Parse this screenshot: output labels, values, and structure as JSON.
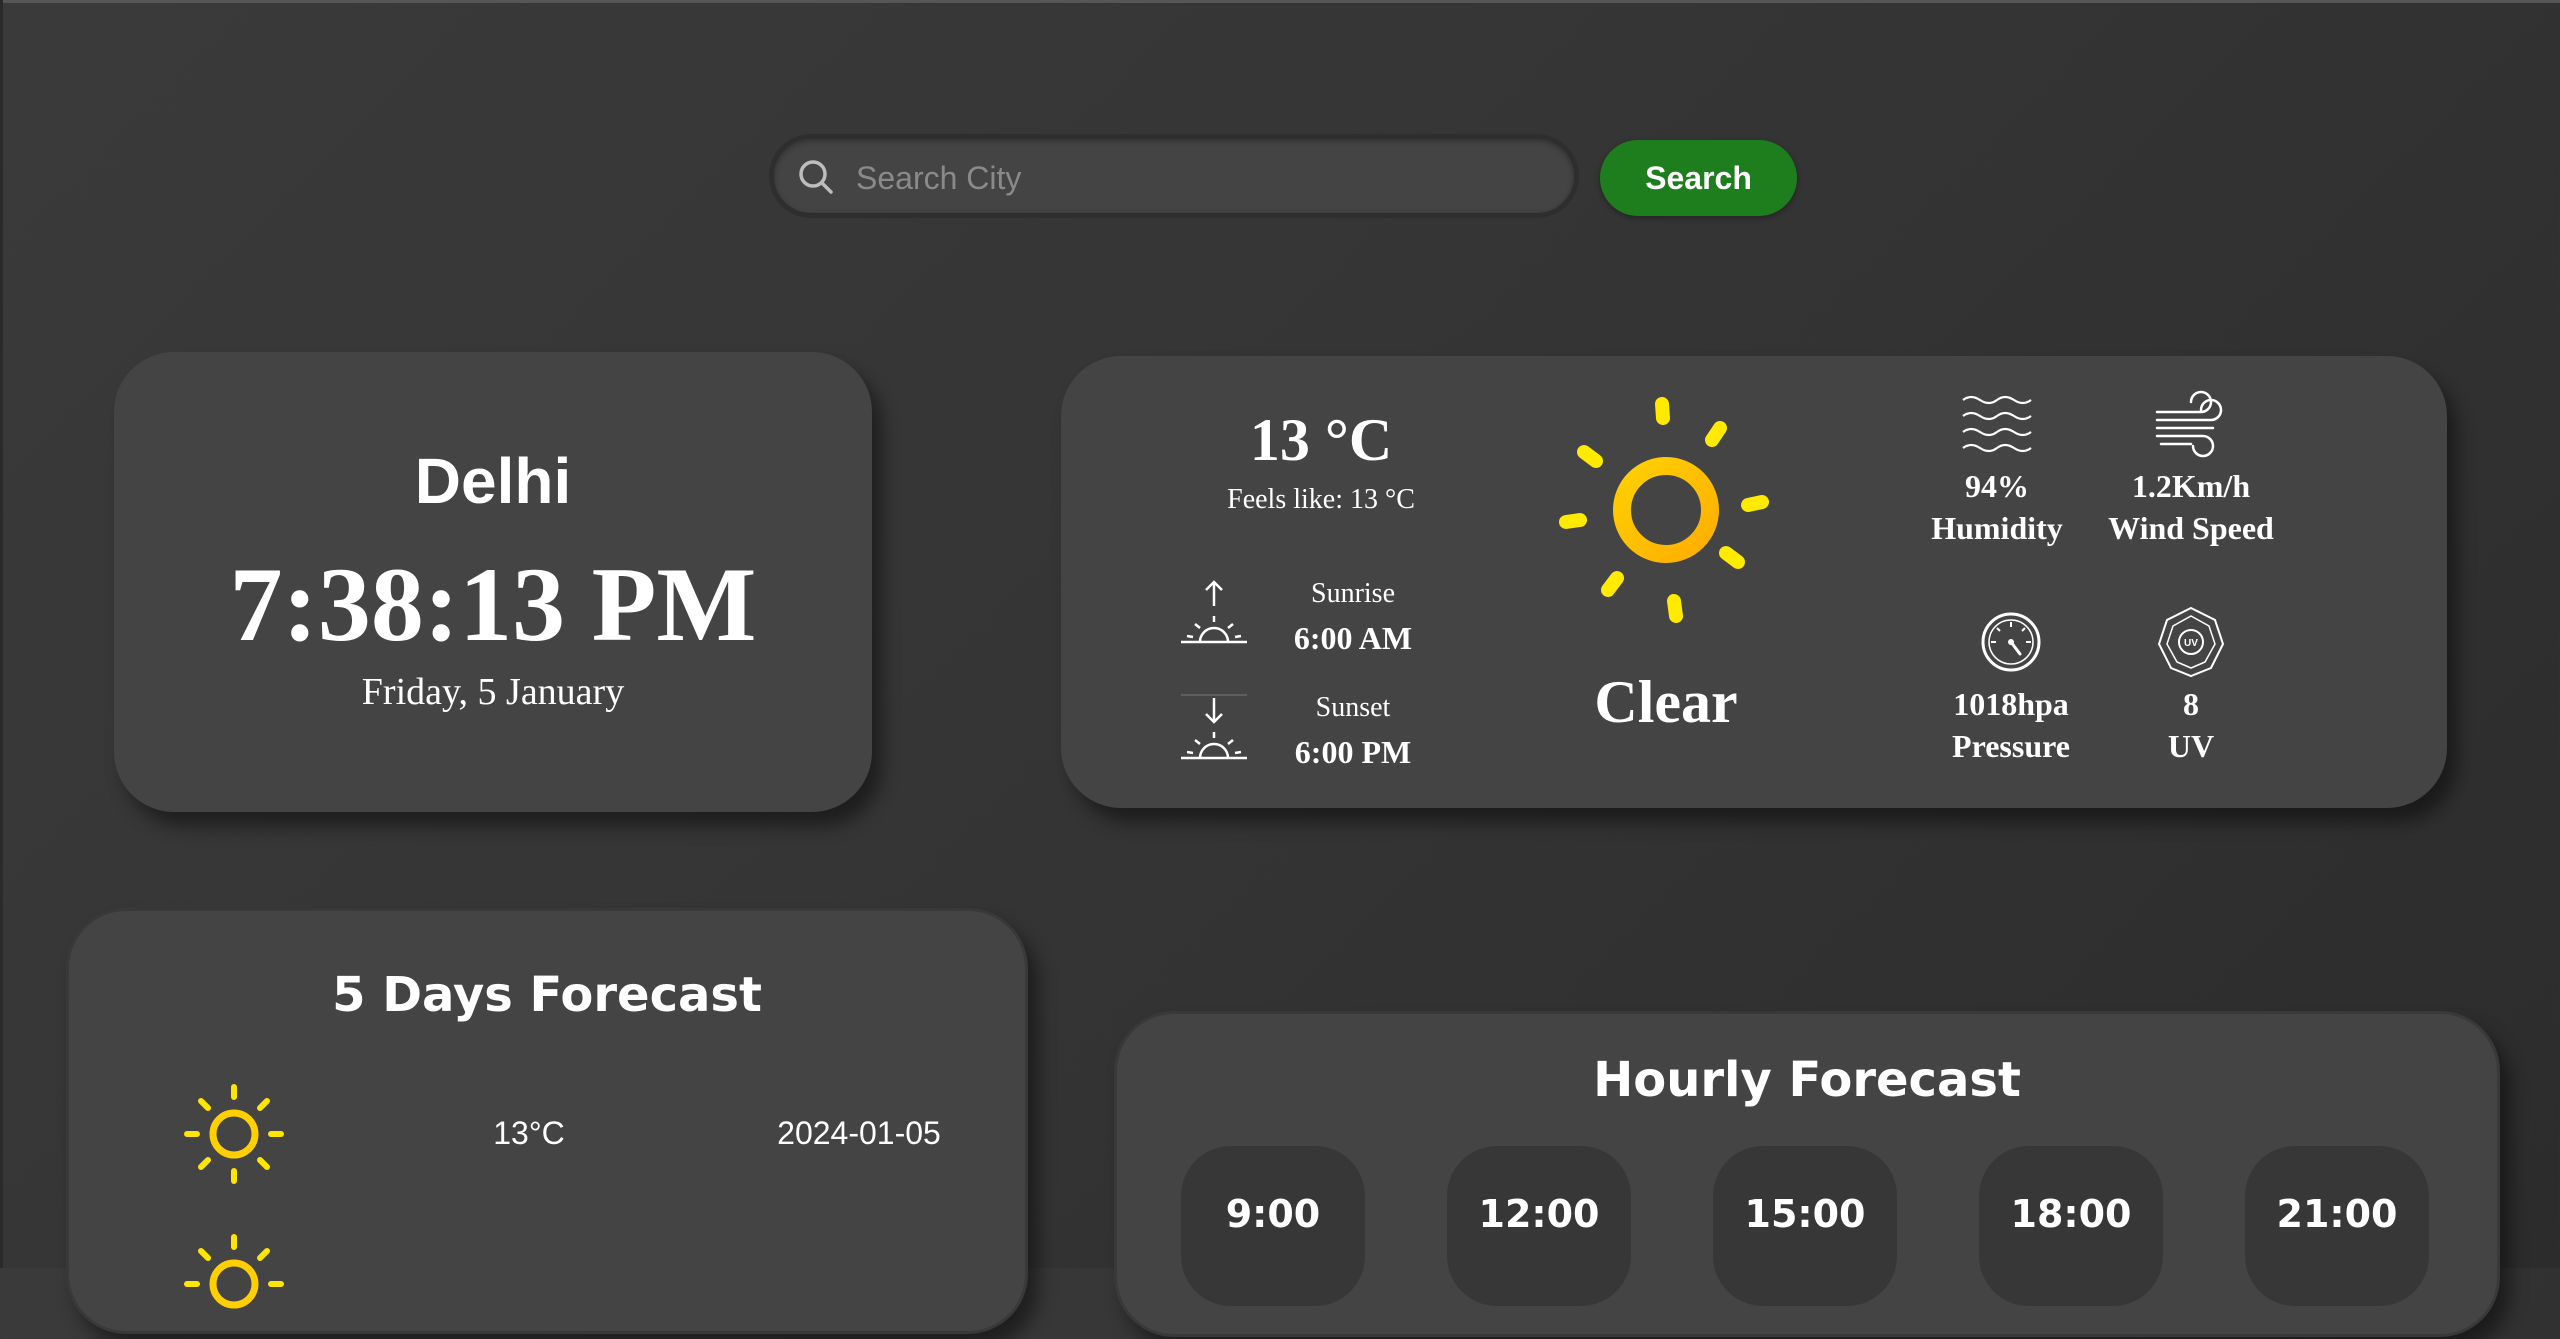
{
  "search": {
    "placeholder": "Search City",
    "value": "",
    "button_label": "Search"
  },
  "city": {
    "name": "Delhi",
    "time": "7:38:13 PM",
    "date": "Friday, 5 January"
  },
  "current": {
    "temperature": "13 °C",
    "feels_like": "Feels like: 13 °C",
    "sunrise_label": "Sunrise",
    "sunrise_time": "6:00 AM",
    "sunset_label": "Sunset",
    "sunset_time": "6:00 PM",
    "condition": "Clear",
    "condition_icon": "sun-icon",
    "stats": {
      "humidity_value": "94%",
      "humidity_label": "Humidity",
      "wind_value": "1.2Km/h",
      "wind_label": "Wind Speed",
      "pressure_value": "1018hpa",
      "pressure_label": "Pressure",
      "uv_value": "8",
      "uv_label": "UV"
    }
  },
  "five_day": {
    "title": "5 Days Forecast",
    "days": [
      {
        "icon": "sun-icon",
        "temp": "13°C",
        "date": "2024-01-05"
      },
      {
        "icon": "sun-icon"
      }
    ]
  },
  "hourly": {
    "title": "Hourly Forecast",
    "hours": [
      "9:00",
      "12:00",
      "15:00",
      "18:00",
      "21:00"
    ]
  },
  "colors": {
    "background": "#363636",
    "card": "#444444",
    "search_button": "#1e7e1e",
    "sun_yellow": "#ffe600",
    "sun_orange": "#ffb300",
    "text": "#ffffff"
  }
}
